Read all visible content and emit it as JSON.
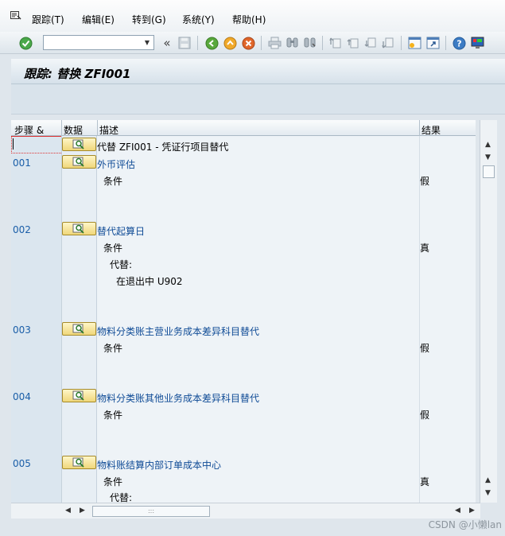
{
  "menu": {
    "items": [
      {
        "label": "跟踪(T)"
      },
      {
        "label": "编辑(E)"
      },
      {
        "label": "转到(G)"
      },
      {
        "label": "系统(Y)"
      },
      {
        "label": "帮助(H)"
      }
    ]
  },
  "toolbar": {
    "command_value": "",
    "icons": [
      "check-icon",
      "back-icon",
      "exit-icon",
      "cancel-icon",
      "print-icon",
      "find-icon",
      "find-next-icon",
      "first-page-icon",
      "prev-page-icon",
      "next-page-icon",
      "last-page-icon",
      "new-session-icon",
      "shortcut-icon",
      "help-icon",
      "customize-icon"
    ]
  },
  "title": "跟踪: 替换 ZFI001",
  "table": {
    "headers": {
      "step": "步骤 &",
      "data": "数据",
      "desc": "描述",
      "result": "结果"
    },
    "root_desc": "代替 ZFI001 - 凭证行项目替代",
    "rows": [
      {
        "step": "001",
        "desc": "外币评估",
        "cond": "条件",
        "result": "假"
      },
      {
        "step": "002",
        "desc": "替代起算日",
        "cond": "条件",
        "result": "真",
        "sub1": "代替:",
        "sub2": "在退出中 U902"
      },
      {
        "step": "003",
        "desc": "物料分类账主营业务成本差异科目替代",
        "cond": "条件",
        "result": "假"
      },
      {
        "step": "004",
        "desc": "物料分类账其他业务成本差异科目替代",
        "cond": "条件",
        "result": "假"
      },
      {
        "step": "005",
        "desc": "物料账结算内部订单成本中心",
        "cond": "条件",
        "result": "真",
        "sub1": "代替:"
      }
    ]
  },
  "watermark": "CSDN @小懒lan"
}
